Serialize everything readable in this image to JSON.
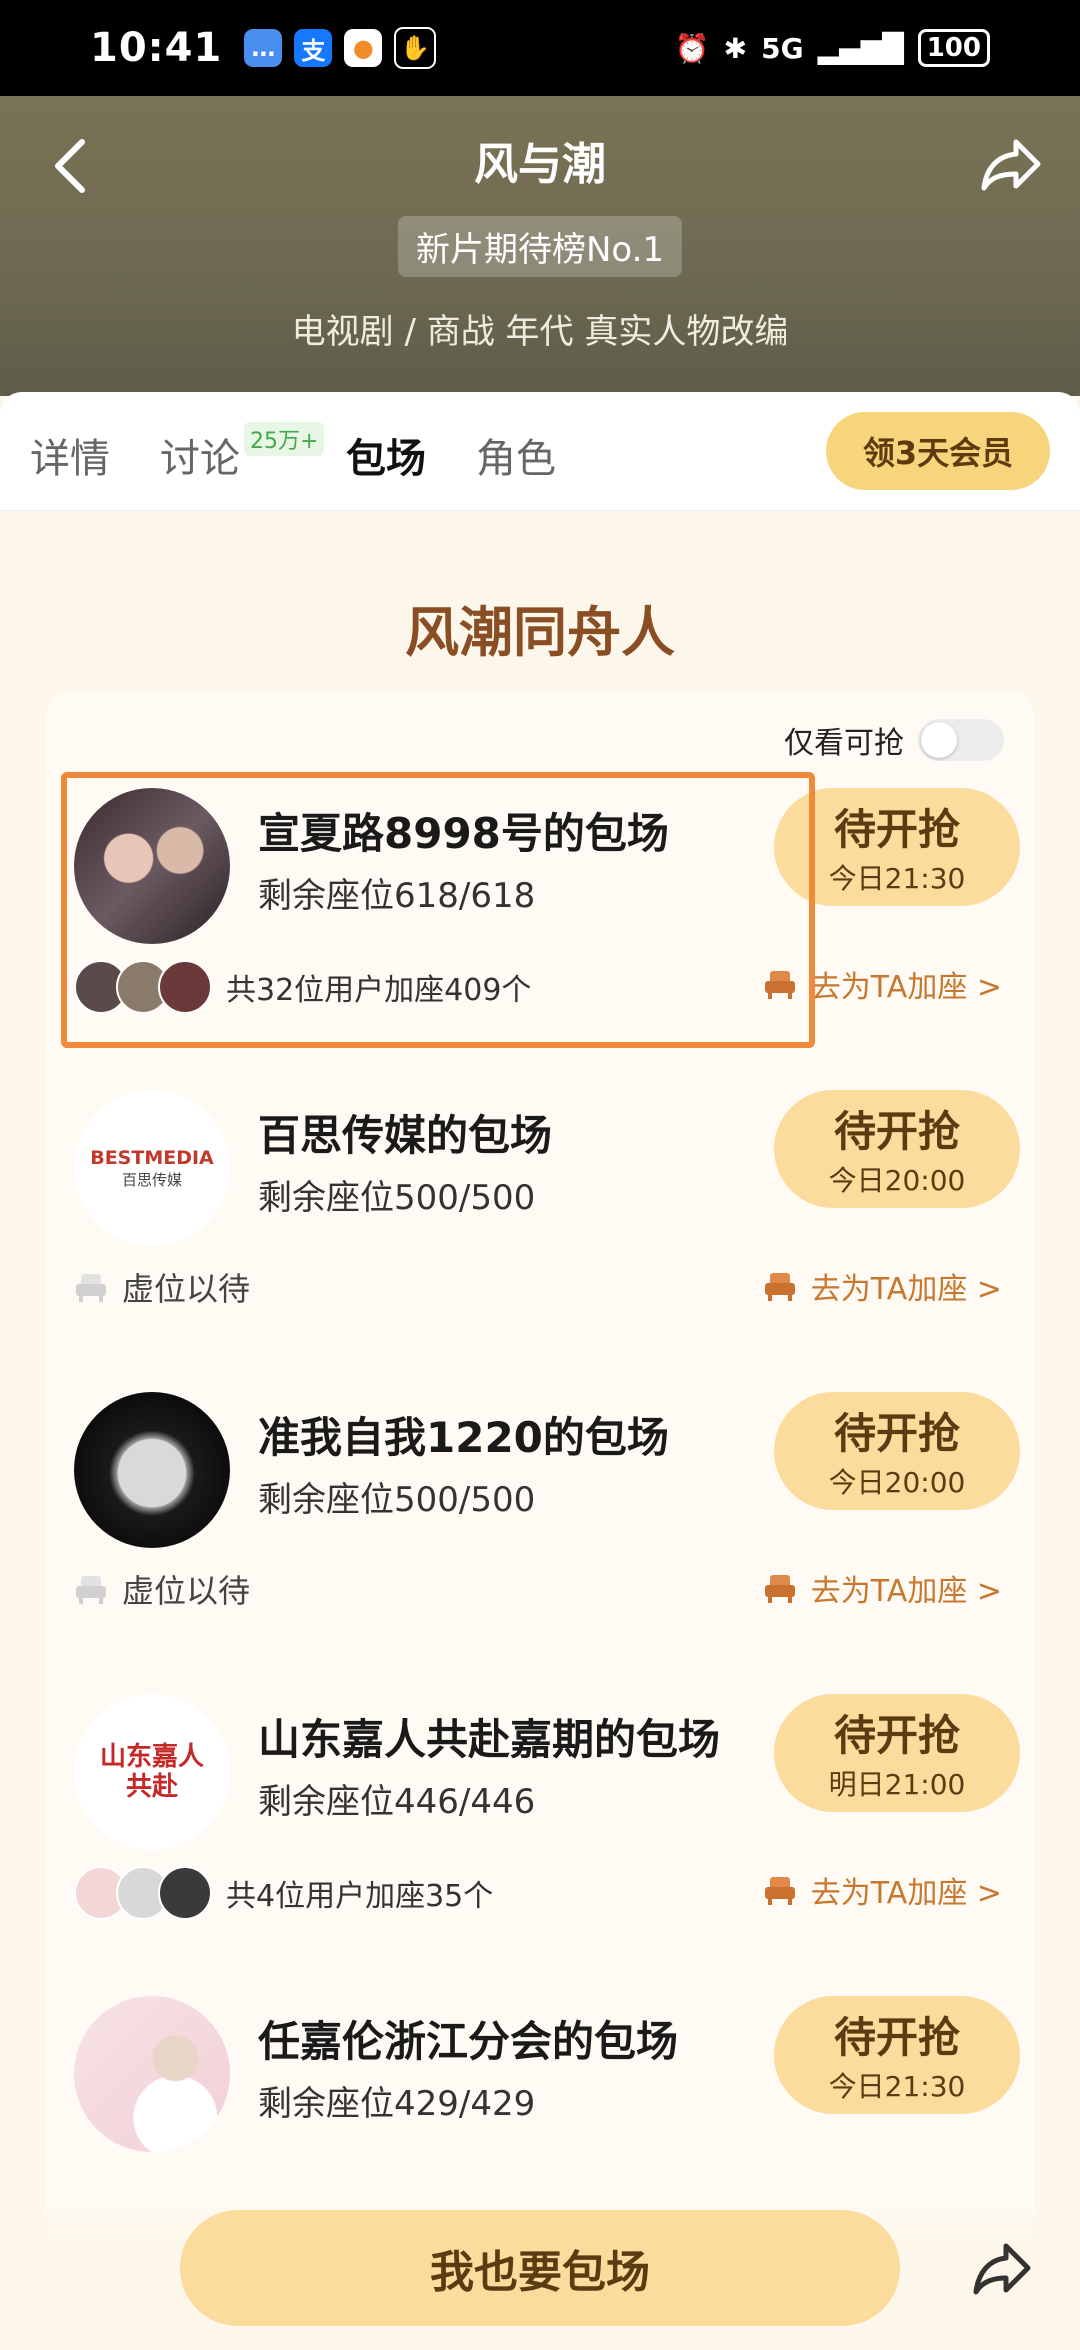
{
  "status_bar": {
    "time": "10:41",
    "network": "5G",
    "battery": "100"
  },
  "header": {
    "title": "风与潮",
    "rank_badge": "新片期待榜No.1",
    "genre": "电视剧 / 商战 年代 真实人物改编"
  },
  "tabs": [
    {
      "label": "详情"
    },
    {
      "label": "讨论",
      "badge": "25万+"
    },
    {
      "label": "包场",
      "active": true
    },
    {
      "label": "角色"
    }
  ],
  "vip_button": "领3天会员",
  "section_title": "风潮同舟人",
  "filter_label": "仅看可抢",
  "cards": [
    {
      "title": "宣夏路8998号的包场",
      "seats": "剩余座位618/618",
      "button_main": "待开抢",
      "button_time": "今日21:30",
      "members_text": "共32位用户加座409个",
      "join_label": "去为TA加座 >"
    },
    {
      "title": "百思传媒的包场",
      "seats": "剩余座位500/500",
      "logo_text": "BESTMEDIA",
      "logo_sub": "百思传媒",
      "button_main": "待开抢",
      "button_time": "今日20:00",
      "vacancy_text": "虚位以待",
      "join_label": "去为TA加座 >"
    },
    {
      "title": "准我自我1220的包场",
      "seats": "剩余座位500/500",
      "button_main": "待开抢",
      "button_time": "今日20:00",
      "vacancy_text": "虚位以待",
      "join_label": "去为TA加座 >"
    },
    {
      "title": "山东嘉人共赴嘉期的包场",
      "seats": "剩余座位446/446",
      "logo_text": "山东嘉人共赴",
      "button_main": "待开抢",
      "button_time": "明日21:00",
      "members_text": "共4位用户加座35个",
      "join_label": "去为TA加座 >"
    },
    {
      "title": "任嘉伦浙江分会的包场",
      "seats": "剩余座位429/429",
      "button_main": "待开抢",
      "button_time": "今日21:30"
    }
  ],
  "bottom_cta": "我也要包场",
  "icons": [
    "back-icon",
    "share-icon",
    "seat-icon",
    "arrow-share-icon"
  ],
  "colors": {
    "accent": "#fbdc9c",
    "section_title": "#8a4e24",
    "join_link": "#c7772e",
    "highlight": "#f08a3a"
  }
}
